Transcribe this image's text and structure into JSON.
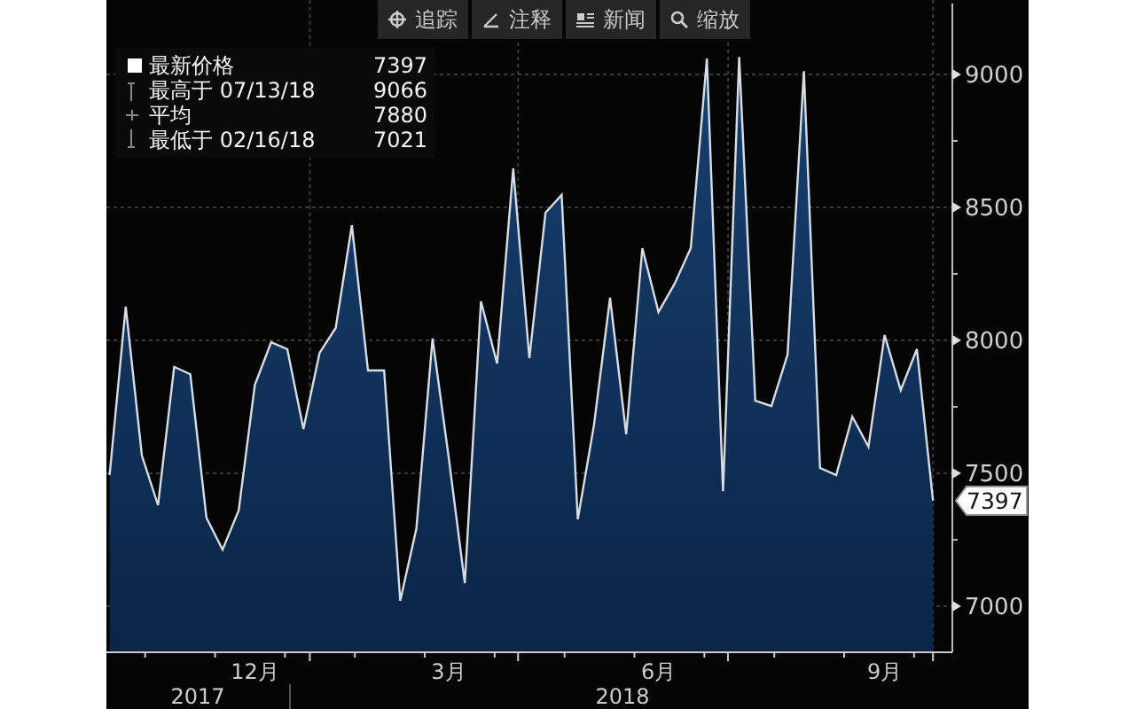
{
  "toolbar": [
    {
      "kind": "track",
      "label": "追踪"
    },
    {
      "kind": "annotate",
      "label": "注释"
    },
    {
      "kind": "news",
      "label": "新闻"
    },
    {
      "kind": "zoom",
      "label": "缩放"
    }
  ],
  "legend": [
    {
      "kind": "last",
      "label": "最新价格",
      "value": "7397"
    },
    {
      "kind": "high",
      "label": "最高于 07/13/18",
      "value": "9066"
    },
    {
      "kind": "average",
      "label": "平均",
      "value": "7880"
    },
    {
      "kind": "low",
      "label": "最低于 02/16/18",
      "value": "7021"
    }
  ],
  "chart": {
    "last_value_label": "7397",
    "year_labels": [
      "2017",
      "2018"
    ],
    "chart_data": {
      "type": "area",
      "categories": [
        null,
        null,
        null,
        null,
        null,
        null,
        null,
        null,
        null,
        "12月",
        null,
        null,
        null,
        null,
        null,
        null,
        null,
        null,
        null,
        null,
        null,
        "3月",
        null,
        null,
        null,
        null,
        null,
        null,
        null,
        null,
        null,
        null,
        null,
        null,
        "6月",
        null,
        null,
        null,
        null,
        null,
        null,
        null,
        null,
        null,
        null,
        null,
        null,
        null,
        "9月",
        null,
        null,
        null
      ],
      "series": [
        {
          "color": "#d8dde4",
          "values": [
            7493,
            8127,
            7567,
            7380,
            7900,
            7873,
            7333,
            7213,
            7360,
            7833,
            7993,
            7967,
            7667,
            7953,
            8047,
            8433,
            7887,
            7887,
            7021,
            7293,
            8007,
            7560,
            7087,
            8147,
            7913,
            8647,
            7933,
            8480,
            8547,
            7327,
            7680,
            8160,
            7647,
            8347,
            8107,
            8213,
            8347,
            9060,
            7433,
            9066,
            7773,
            7753,
            7947,
            9013,
            7520,
            7493,
            7713,
            7600,
            8020,
            7813,
            7967,
            7397
          ]
        }
      ],
      "ylim": [
        6827,
        9280
      ],
      "grid": true,
      "yticks": [
        7000,
        7500,
        8000,
        8500,
        9000
      ]
    }
  }
}
